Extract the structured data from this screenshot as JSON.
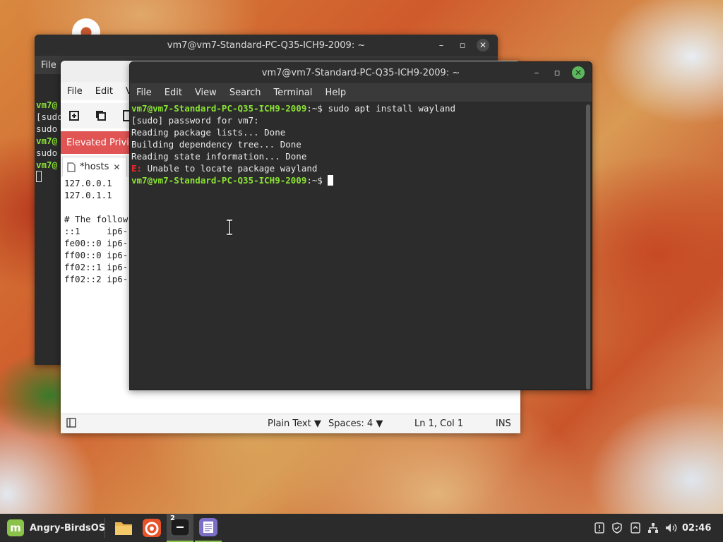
{
  "desktop": {},
  "back_terminal": {
    "title": "vm7@vm7-Standard-PC-Q35-ICH9-2009: ~",
    "menu": [
      "File"
    ],
    "lines": [
      "vm7@",
      "[sudo",
      "sudo",
      "vm7@",
      "sudo",
      "vm7@"
    ]
  },
  "editor": {
    "menu": [
      "File",
      "Edit",
      "Vi"
    ],
    "banner": "Elevated Privile",
    "tab_label": "*hosts",
    "lines": [
      "127.0.0.1",
      "127.0.1.1",
      "",
      "# The follow",
      "::1     ip6-",
      "fe00::0 ip6-",
      "ff00::0 ip6-",
      "ff02::1 ip6-",
      "ff02::2 ip6-"
    ],
    "status": {
      "language": "Plain Text",
      "spaces": "Spaces: 4",
      "position": "Ln 1, Col 1",
      "mode": "INS"
    }
  },
  "front_terminal": {
    "title": "vm7@vm7-Standard-PC-Q35-ICH9-2009: ~",
    "menu": [
      "File",
      "Edit",
      "View",
      "Search",
      "Terminal",
      "Help"
    ],
    "prompt": "vm7@vm7-Standard-PC-Q35-ICH9-2009",
    "prompt_suffix": ":~$ ",
    "command": "sudo apt install wayland",
    "output": [
      "[sudo] password for vm7:",
      "Reading package lists... Done",
      "Building dependency tree... Done",
      "Reading state information... Done"
    ],
    "error_prefix": "E:",
    "error_text": " Unable to locate package wayland"
  },
  "taskbar": {
    "menu_label": "Angry-BirdsOS",
    "terminal_badge": "2",
    "clock": "02:46",
    "icons": [
      "files-icon",
      "firefox-icon",
      "terminal-icon",
      "text-editor-icon"
    ],
    "tray_icons": [
      "notification-icon",
      "shield-icon",
      "update-icon",
      "network-icon",
      "volume-icon"
    ]
  }
}
